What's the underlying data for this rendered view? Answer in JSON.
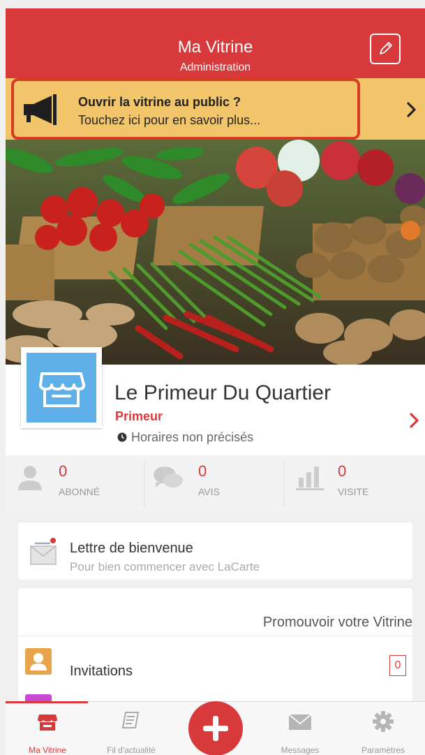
{
  "header": {
    "title": "Ma Vitrine",
    "subtitle": "Administration",
    "edit_icon": "pencil-icon"
  },
  "banner": {
    "title": "Ouvrir la vitrine au public ?",
    "subtitle": "Touchez ici pour en savoir plus...",
    "icon": "megaphone-icon",
    "chevron": "›"
  },
  "store": {
    "name": "Le Primeur Du Quartier",
    "category": "Primeur",
    "hours": "Horaires non précisés",
    "chevron": "›"
  },
  "stats": [
    {
      "value": "0",
      "label": "ABONNÉ",
      "icon": "person-icon"
    },
    {
      "value": "0",
      "label": "AVIS",
      "icon": "chat-icon"
    },
    {
      "value": "0",
      "label": "VISITE",
      "icon": "bar-chart-icon"
    }
  ],
  "welcome": {
    "title": "Lettre de bienvenue",
    "subtitle": "Pour bien commencer avec LaCarte",
    "icon": "envelope-icon"
  },
  "promo": {
    "header": "Promouvoir votre Vitrine",
    "invitations_label": "Invitations",
    "invitations_count": "0"
  },
  "tabbar": {
    "items": [
      {
        "label": "Ma Vitrine",
        "icon": "store-icon",
        "active": true
      },
      {
        "label": "Fil d'actualité",
        "icon": "feed-icon",
        "active": false
      },
      {
        "label": "Messages",
        "icon": "mail-icon",
        "active": false
      },
      {
        "label": "Paramètres",
        "icon": "gear-icon",
        "active": false
      }
    ],
    "fab_icon": "plus-icon"
  },
  "colors": {
    "brand_red": "#d8393a",
    "banner_yellow": "#f2c56b",
    "logo_blue": "#5fb0e8"
  }
}
